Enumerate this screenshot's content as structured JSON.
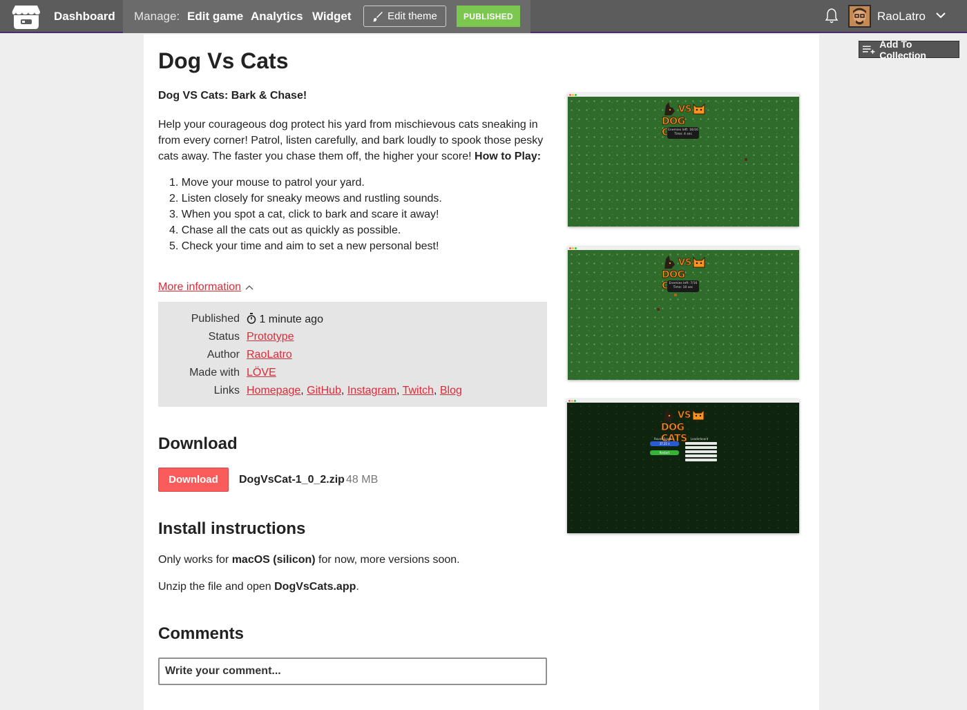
{
  "topbar": {
    "dashboard": "Dashboard",
    "manage_label": "Manage:",
    "edit_game": "Edit game",
    "analytics": "Analytics",
    "widget": "Widget",
    "edit_theme": "Edit theme",
    "published": "PUBLISHED",
    "username": "RaoLatro",
    "accent_color": "#4c2a6e"
  },
  "add_to_collection": "Add To Collection",
  "game": {
    "title": "Dog Vs Cats",
    "tagline": "Dog VS Cats: Bark & Chase!",
    "description": "Help your courageous dog protect his yard from mischievous cats sneaking in from every corner! Patrol, listen carefully, and bark loudly to spook those pesky cats away. The faster you chase them off, the higher your score!",
    "how_to_play": "How to Play:",
    "steps": [
      "1. Move your mouse to patrol your yard.",
      "2. Listen closely for sneaky meows and rustling sounds.",
      "3. When you spot a cat, click to bark and scare it away!",
      "4. Chase all the cats out as quickly as possible.",
      "5. Check your time and aim to set a new personal best!"
    ]
  },
  "more_info": {
    "toggle": "More information",
    "published_label": "Published",
    "published_value": "1 minute ago",
    "status_label": "Status",
    "status_value": "Prototype",
    "author_label": "Author",
    "author_value": "RaoLatro",
    "made_with_label": "Made with",
    "made_with_value": "LÖVE",
    "links_label": "Links",
    "links": [
      "Homepage",
      "GitHub",
      "Instagram",
      "Twitch",
      "Blog"
    ],
    "separator": ", "
  },
  "download": {
    "heading": "Download",
    "button": "Download",
    "file_name": "DogVsCat-1_0_2.zip",
    "file_size": "48 MB"
  },
  "install": {
    "heading": "Install instructions",
    "line1_pre": "Only works for ",
    "line1_bold": "macOS (silicon)",
    "line1_post": " for now, more versions soon.",
    "line2_pre": "Unzip the file and open ",
    "line2_bold": "DogVsCats.app",
    "line2_post": "."
  },
  "comments": {
    "heading": "Comments",
    "placeholder": "Write your comment..."
  },
  "screenshots": {
    "logo_vs": "VS",
    "logo_dog_cats": "DOG CATS",
    "shot1_hud_line1": "Enemies left: 16/16",
    "shot1_hud_line2": "Time: 4 sec",
    "shot2_hud_line1": "Enemies left: 7/16",
    "shot2_hud_line2": "Time: 10 sec",
    "shot3_round_score": "Round Score",
    "shot3_leaderboard": "Leaderboard",
    "shot3_score": "37.21 s",
    "shot3_restart": "Restart"
  },
  "colors": {
    "link": "#da2c38",
    "download_button": "#fa5c5c",
    "published_badge": "#7bc750"
  }
}
